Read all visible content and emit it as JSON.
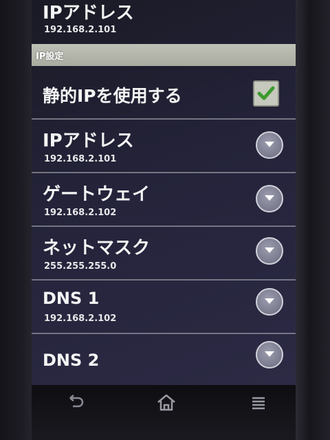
{
  "top_item": {
    "title": "IPアドレス",
    "summary": "192.168.2.101"
  },
  "section_header": "IP設定",
  "static_ip": {
    "label": "静的IPを使用する",
    "checked": true
  },
  "settings": [
    {
      "title": "IPアドレス",
      "summary": "192.168.2.101"
    },
    {
      "title": "ゲートウェイ",
      "summary": "192.168.2.102"
    },
    {
      "title": "ネットマスク",
      "summary": "255.255.255.0"
    },
    {
      "title": "DNS 1",
      "summary": "192.168.2.102"
    },
    {
      "title": "DNS 2",
      "summary": ""
    }
  ],
  "icons": {
    "checkbox": "checkmark-icon",
    "dropdown": "chevron-down-icon",
    "nav": [
      "back-icon",
      "home-icon",
      "menu-icon"
    ]
  },
  "colors": {
    "accent_check": "#3b9a2e",
    "section_bg": "#b3b5aa"
  }
}
